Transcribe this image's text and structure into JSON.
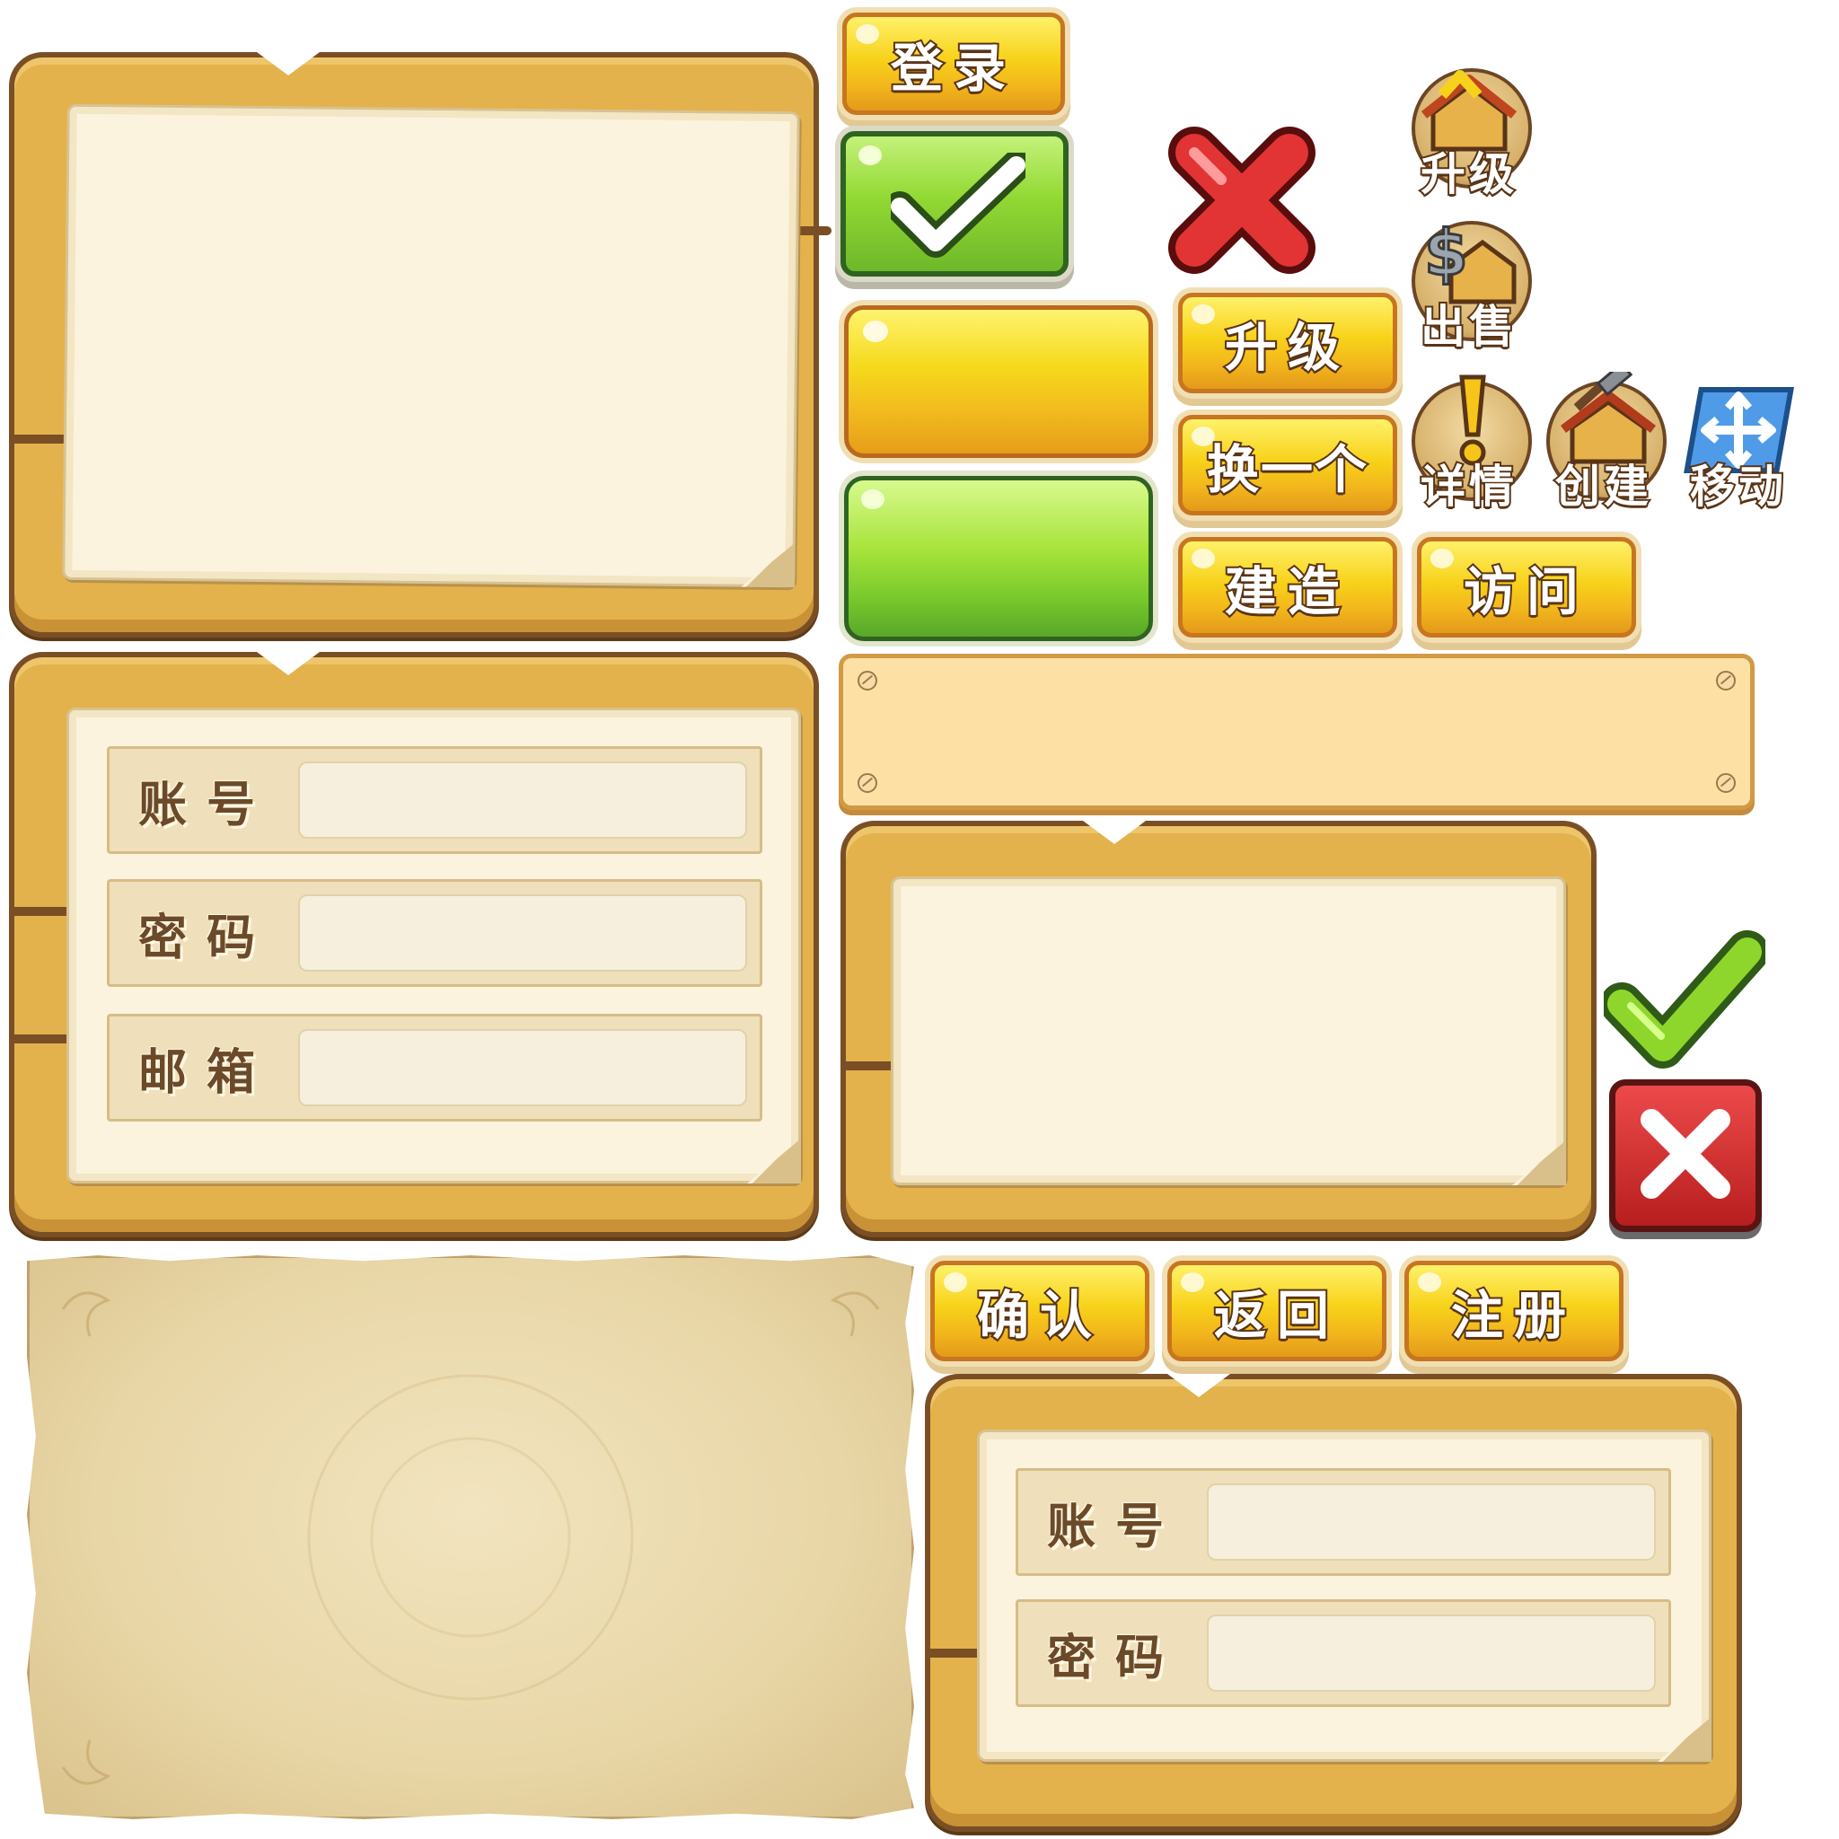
{
  "buttons": {
    "login": "登录",
    "upgrade": "升级",
    "swap": "换一个",
    "build": "建造",
    "visit": "访问",
    "confirm": "确认",
    "back": "返回",
    "register": "注册"
  },
  "icons": {
    "upgrade": "升级",
    "sell": "出售",
    "details": "详情",
    "create": "创建",
    "move": "移动"
  },
  "form_register": {
    "account_label": "账号",
    "password_label": "密码",
    "email_label": "邮箱"
  },
  "form_login": {
    "account_label": "账号",
    "password_label": "密码"
  },
  "colors": {
    "board": "#e3b24c",
    "board_border": "#7a4f25",
    "button_yellow": "#f7d21a",
    "button_green": "#93d934",
    "close_red": "#d62a2a",
    "check_green": "#8ed62c"
  }
}
